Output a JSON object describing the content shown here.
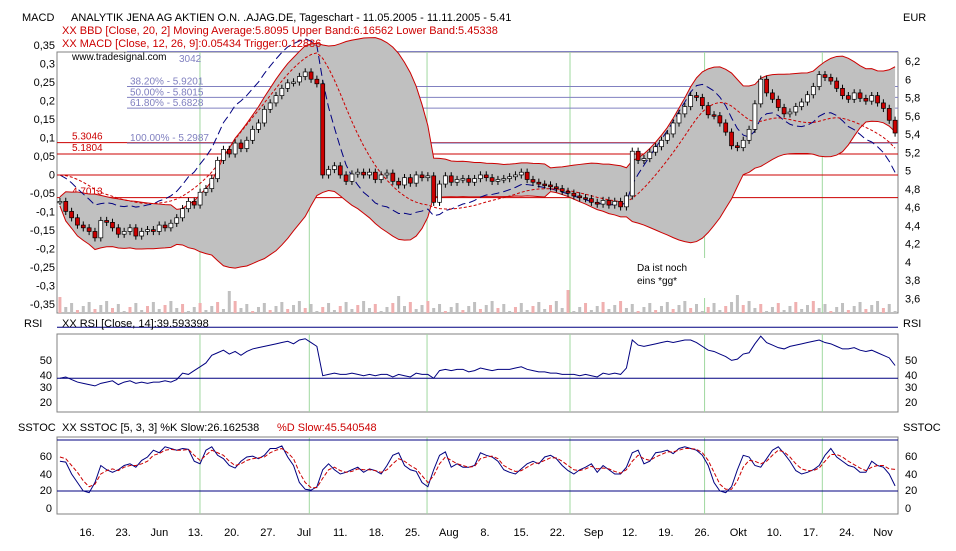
{
  "header": {
    "title": "ANALYTIK JENA AG AKTIEN O.N. .AJAG.DE, Tageschart - 11.05.2005 - 11.11.2005 - 5.41",
    "bbd": "XX BBD [Close, 20, 2] Moving Average:5.8095 Upper Band:6.16562 Lower Band:5.45338",
    "macd": "XX MACD [Close, 12, 26, 9]:0.05434 Trigger:0.12886",
    "source": "www.tradesignal.com"
  },
  "panels": {
    "main": {
      "left_label": "MACD",
      "right_label": "EUR",
      "left_ticks": [
        "0,35",
        "0,3",
        "0,25",
        "0,2",
        "0,15",
        "0,1",
        "0,05",
        "0",
        "-0,05",
        "-0,1",
        "-0,15",
        "-0,2",
        "-0,25",
        "-0,3",
        "-0,35"
      ],
      "right_ticks": [
        "6,2",
        "6",
        "5,8",
        "5,6",
        "5,4",
        "5,2",
        "5",
        "4,8",
        "4,6",
        "4,4",
        "4,2",
        "4",
        "3,8",
        "3,6"
      ]
    },
    "rsi": {
      "left_label": "RSI",
      "right_label": "RSI",
      "legend": "XX RSI [Close, 14]:39.593398",
      "ticks": [
        "50",
        "40",
        "30",
        "20"
      ]
    },
    "sstoc": {
      "left_label": "SSTOC",
      "right_label": "SSTOC",
      "legend_k": "XX SSTOC [5, 3, 3] %K Slow:26.162538",
      "legend_d": "%D Slow:45.540548",
      "ticks": [
        "60",
        "40",
        "20",
        "0"
      ]
    }
  },
  "levels": {
    "price_labels": [
      "5.3046",
      "5.1804",
      "4.7013"
    ],
    "fib_labels": [
      "38.20% - 5.9201",
      "50.00% - 5.8015",
      "61.80% - 5.6828",
      "100.00% - 5.2987"
    ],
    "top_partial": "3042"
  },
  "annotation": {
    "line1": "Da ist noch",
    "line2": "eins *gg*"
  },
  "x_ticks": [
    "16.",
    "23.",
    "Jun",
    "13.",
    "20.",
    "27.",
    "Jul",
    "11.",
    "18.",
    "25.",
    "Aug",
    "8.",
    "15.",
    "22.",
    "Sep",
    "12.",
    "19.",
    "26.",
    "Okt",
    "10.",
    "17.",
    "24.",
    "Nov"
  ],
  "colors": {
    "price_up": "#ffffff",
    "price_down": "#cc0000",
    "band": "#cc0000",
    "band_fill": "#c0c0c0",
    "trigger": "#cc0000",
    "macd": "#000080",
    "rsi": "#000080",
    "stoch_k": "#000080",
    "stoch_d": "#cc0000",
    "grid": "#000080"
  },
  "chart_data": {
    "type": "candlestick",
    "period": "11.05.2005 - 11.11.2005",
    "last_close": 5.41,
    "bollinger": {
      "ma": 5.8095,
      "upper": 6.16562,
      "lower": 5.45338
    },
    "macd": {
      "value": 0.05434,
      "trigger": 0.12886
    },
    "rsi": {
      "value": 39.593398,
      "period": 14
    },
    "sstoc": {
      "k_slow": 26.162538,
      "d_slow": 45.540548
    },
    "price_scale": [
      3.6,
      6.2
    ],
    "macd_scale": [
      -0.35,
      0.35
    ],
    "close": [
      4.66,
      4.55,
      4.48,
      4.4,
      4.37,
      4.33,
      4.26,
      4.45,
      4.43,
      4.37,
      4.3,
      4.33,
      4.37,
      4.28,
      4.33,
      4.35,
      4.33,
      4.4,
      4.37,
      4.42,
      4.48,
      4.58,
      4.66,
      4.62,
      4.76,
      4.8,
      4.91,
      5.11,
      5.23,
      5.18,
      5.3,
      5.24,
      5.33,
      5.45,
      5.52,
      5.67,
      5.74,
      5.82,
      5.9,
      5.96,
      5.97,
      6.03,
      6.08,
      6.0,
      5.95,
      4.95,
      5.01,
      5.05,
      4.95,
      4.88,
      4.96,
      4.98,
      4.95,
      4.98,
      4.9,
      4.95,
      4.97,
      4.88,
      4.84,
      4.92,
      4.86,
      4.95,
      4.92,
      4.94,
      4.65,
      4.85,
      4.94,
      4.87,
      4.9,
      4.91,
      4.87,
      4.91,
      4.95,
      4.92,
      4.88,
      4.9,
      4.91,
      4.93,
      4.95,
      4.98,
      4.9,
      4.87,
      4.85,
      4.84,
      4.82,
      4.8,
      4.77,
      4.75,
      4.72,
      4.7,
      4.69,
      4.65,
      4.63,
      4.67,
      4.62,
      4.66,
      4.6,
      4.72,
      5.21,
      5.11,
      5.13,
      5.2,
      5.26,
      5.33,
      5.4,
      5.52,
      5.62,
      5.7,
      5.82,
      5.8,
      5.71,
      5.61,
      5.6,
      5.52,
      5.42,
      5.27,
      5.25,
      5.33,
      5.45,
      5.73,
      6.0,
      5.85,
      5.78,
      5.69,
      5.62,
      5.64,
      5.7,
      5.75,
      5.83,
      5.92,
      6.05,
      6.02,
      5.98,
      5.9,
      5.82,
      5.78,
      5.85,
      5.79,
      5.76,
      5.82,
      5.74,
      5.68,
      5.55,
      5.41
    ],
    "rsi_values": [
      30,
      31,
      29,
      27,
      26,
      25,
      24,
      26,
      27,
      28,
      25,
      27,
      28,
      26,
      27,
      26,
      27,
      27,
      28,
      27,
      29,
      34,
      33,
      36,
      39,
      42,
      48,
      50,
      52,
      49,
      51,
      48,
      51,
      53,
      54,
      55,
      56,
      57,
      58,
      59,
      57,
      60,
      61,
      58,
      55,
      32,
      33,
      34,
      33,
      33,
      34,
      33,
      32,
      33,
      32,
      33,
      33,
      31,
      33,
      32,
      31,
      34,
      33,
      33,
      30,
      36,
      37,
      36,
      37,
      37,
      35,
      36,
      38,
      37,
      36,
      37,
      37,
      37,
      38,
      39,
      37,
      36,
      35,
      35,
      34,
      34,
      33,
      33,
      33,
      32,
      33,
      32,
      31,
      34,
      33,
      34,
      33,
      38,
      60,
      56,
      55,
      56,
      57,
      58,
      59,
      58,
      59,
      60,
      60,
      58,
      55,
      52,
      51,
      49,
      47,
      44,
      45,
      49,
      50,
      57,
      63,
      58,
      56,
      54,
      53,
      55,
      56,
      57,
      58,
      59,
      60,
      58,
      57,
      55,
      53,
      53,
      54,
      52,
      51,
      52,
      50,
      48,
      46,
      40
    ],
    "stoch_k_values": [
      55,
      54,
      40,
      30,
      20,
      18,
      30,
      50,
      45,
      42,
      45,
      50,
      52,
      48,
      56,
      60,
      68,
      65,
      72,
      70,
      68,
      70,
      69,
      55,
      52,
      68,
      72,
      62,
      58,
      50,
      47,
      55,
      60,
      61,
      58,
      62,
      70,
      70,
      73,
      60,
      50,
      30,
      22,
      21,
      25,
      45,
      52,
      45,
      40,
      42,
      45,
      48,
      42,
      46,
      44,
      40,
      50,
      62,
      65,
      50,
      45,
      43,
      30,
      25,
      45,
      62,
      66,
      48,
      52,
      48,
      48,
      50,
      65,
      62,
      60,
      55,
      45,
      42,
      40,
      46,
      52,
      55,
      52,
      60,
      62,
      58,
      50,
      44,
      40,
      45,
      48,
      52,
      42,
      50,
      45,
      40,
      40,
      48,
      65,
      68,
      52,
      55,
      65,
      66,
      68,
      64,
      70,
      72,
      70,
      68,
      62,
      50,
      30,
      20,
      18,
      25,
      45,
      62,
      60,
      50,
      48,
      58,
      68,
      72,
      64,
      55,
      44,
      40,
      42,
      45,
      50,
      62,
      70,
      60,
      55,
      50,
      48,
      42,
      42,
      55,
      50,
      48,
      40,
      26
    ],
    "stoch_d_values": [
      60,
      58,
      50,
      42,
      32,
      25,
      28,
      40,
      44,
      46,
      44,
      48,
      50,
      50,
      52,
      55,
      62,
      64,
      68,
      69,
      68,
      68,
      69,
      62,
      56,
      62,
      68,
      65,
      62,
      55,
      50,
      52,
      56,
      58,
      59,
      60,
      65,
      68,
      70,
      65,
      58,
      42,
      30,
      24,
      24,
      35,
      45,
      48,
      44,
      42,
      43,
      46,
      45,
      45,
      44,
      42,
      45,
      52,
      58,
      55,
      50,
      46,
      38,
      30,
      38,
      52,
      60,
      56,
      52,
      50,
      48,
      49,
      58,
      60,
      61,
      58,
      50,
      46,
      43,
      44,
      48,
      52,
      53,
      56,
      59,
      59,
      55,
      50,
      45,
      44,
      46,
      49,
      46,
      47,
      46,
      43,
      41,
      45,
      55,
      62,
      58,
      56,
      60,
      63,
      66,
      66,
      68,
      70,
      70,
      69,
      65,
      56,
      42,
      28,
      22,
      22,
      32,
      48,
      56,
      55,
      52,
      55,
      62,
      68,
      66,
      60,
      52,
      46,
      44,
      44,
      47,
      55,
      63,
      63,
      60,
      55,
      51,
      47,
      44,
      48,
      50,
      50,
      46,
      45.5
    ]
  }
}
